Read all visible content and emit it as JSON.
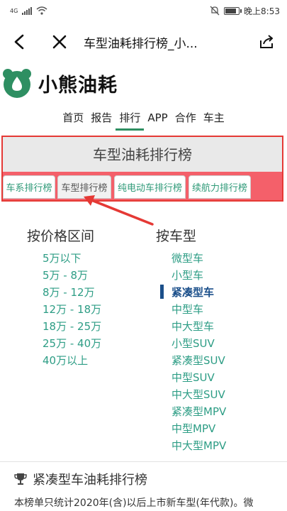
{
  "status_bar": {
    "carrier": "4G",
    "time": "晚上8:53",
    "icons": [
      "signal-icon",
      "wifi-icon",
      "mute-icon",
      "battery-icon"
    ]
  },
  "navbar": {
    "title": "车型油耗排行榜_小...",
    "icons": [
      "back-icon",
      "close-icon",
      "share-icon"
    ]
  },
  "logo": {
    "text": "小熊油耗",
    "icon": "bear-logo-icon",
    "color": "#2e8f62"
  },
  "main_nav": {
    "items": [
      "首页",
      "报告",
      "排行",
      "APP",
      "合作",
      "车主"
    ],
    "active_index": 2
  },
  "rank_panel": {
    "title": "车型油耗排行榜",
    "tabs": [
      "车系排行榜",
      "车型排行榜",
      "纯电动车排行榜",
      "续航力排行榜"
    ],
    "active_tab": 1,
    "highlight_color": "#e53935"
  },
  "price_filter": {
    "heading": "按价格区间",
    "items": [
      "5万以下",
      "5万 - 8万",
      "8万 - 12万",
      "12万 - 18万",
      "18万 - 25万",
      "25万 - 40万",
      "40万以上"
    ]
  },
  "type_filter": {
    "heading": "按车型",
    "items": [
      "微型车",
      "小型车",
      "紧凑型车",
      "中型车",
      "中大型车",
      "小型SUV",
      "紧凑型SUV",
      "中型SUV",
      "中大型SUV",
      "紧凑型MPV",
      "中型MPV",
      "中大型MPV"
    ],
    "current_index": 2
  },
  "section": {
    "icon": "trophy-icon",
    "title": "紧凑型车油耗排行榜",
    "text": "本榜单只统计2020年(含)以后上市新车型(年代款)。微"
  }
}
